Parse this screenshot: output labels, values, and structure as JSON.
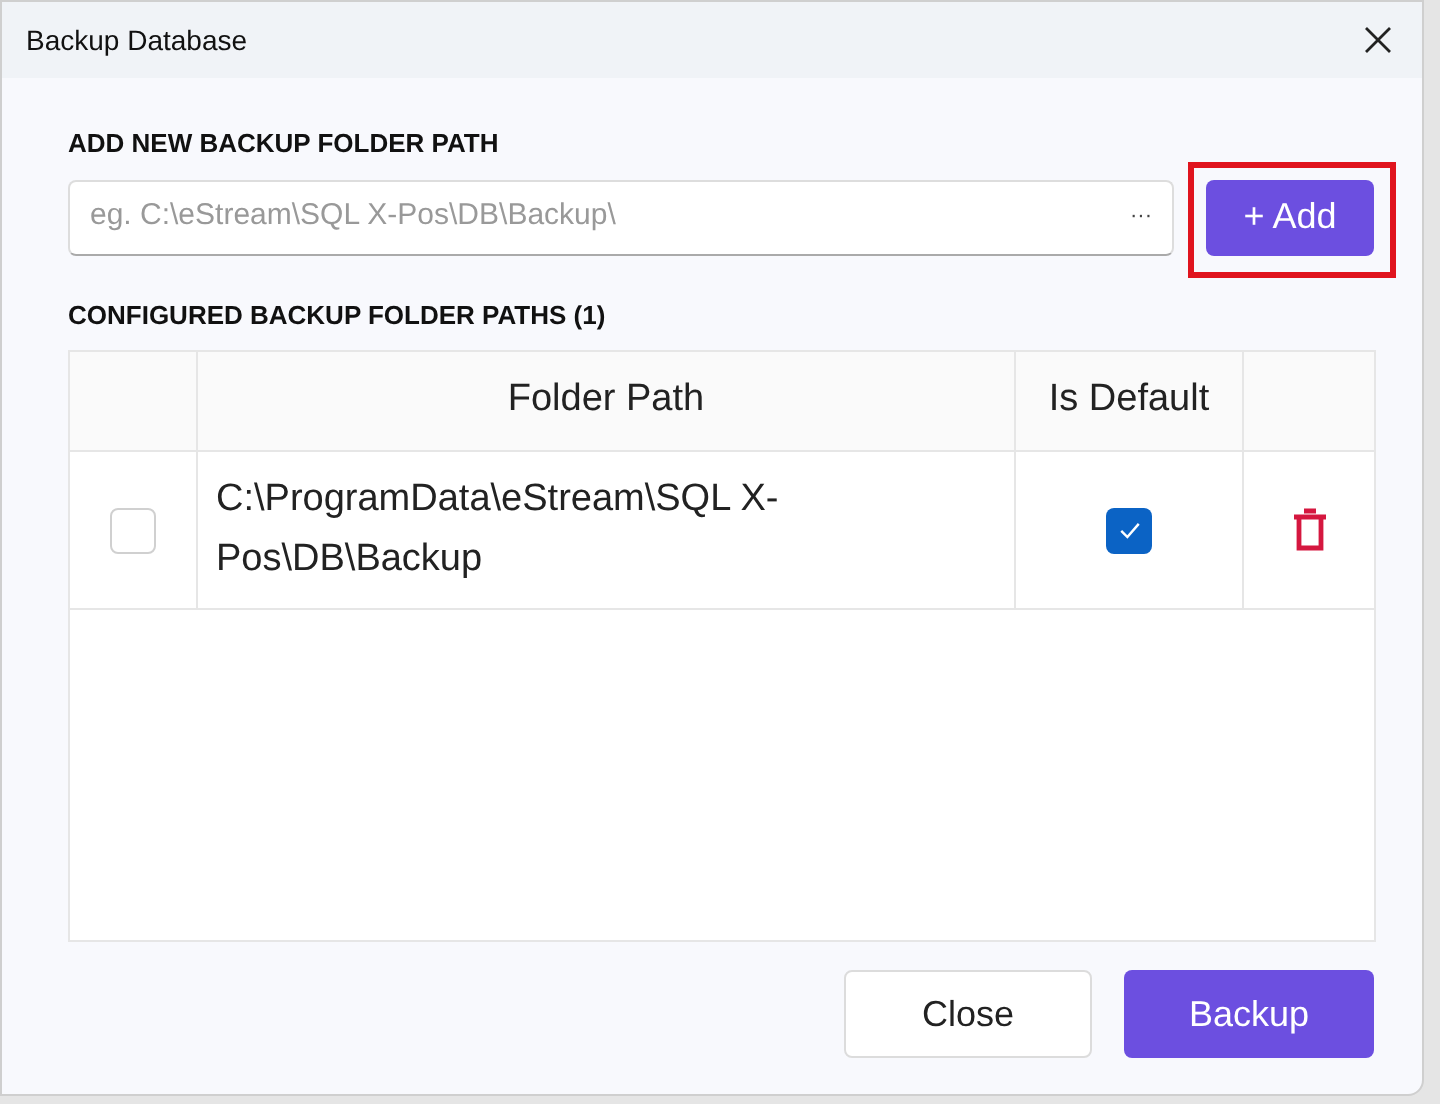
{
  "window": {
    "title": "Backup Database"
  },
  "add_section": {
    "label": "ADD NEW BACKUP FOLDER PATH",
    "path_field": {
      "placeholder": "eg. C:\\eStream\\SQL X-Pos\\DB\\Backup\\",
      "browse": "···"
    },
    "add_button": "+ Add",
    "highlighted": true
  },
  "configured_section": {
    "label": "CONFIGURED BACKUP FOLDER PATHS (1)"
  },
  "table": {
    "columns": [
      "Folder Path",
      "Is Default"
    ],
    "rows": [
      {
        "selected": false,
        "folder_path": "C:\\ProgramData\\eStream\\SQL X-Pos\\DB\\Backup",
        "is_default": true
      }
    ]
  },
  "buttons": [
    {
      "label": "Close",
      "kind": "secondary"
    },
    {
      "label": "Backup",
      "kind": "primary"
    }
  ]
}
